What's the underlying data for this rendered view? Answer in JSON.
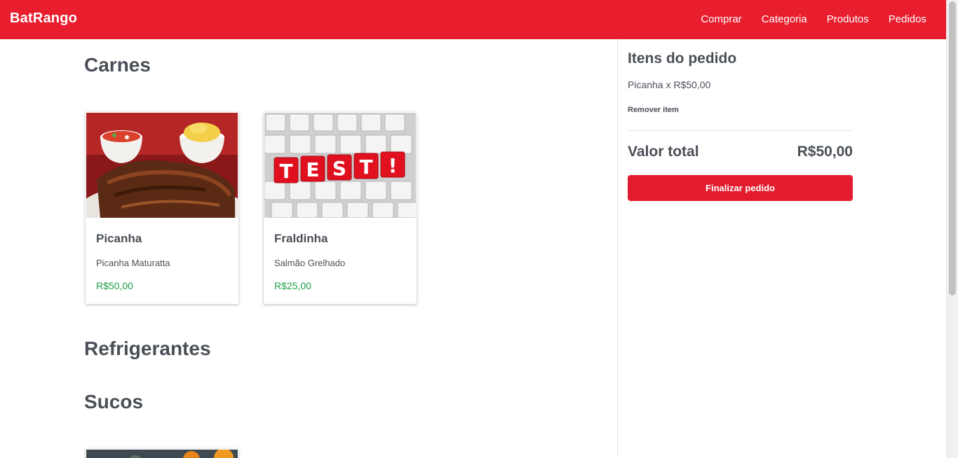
{
  "navbar": {
    "brand": "BatRango",
    "links": [
      "Comprar",
      "Categoria",
      "Produtos",
      "Pedidos"
    ]
  },
  "sections": [
    {
      "title": "Carnes",
      "products": [
        {
          "name": "Picanha",
          "description": "Picanha Maturatta",
          "price": "R$50,00",
          "image": "meat-dish-image"
        },
        {
          "name": "Fraldinha",
          "description": "Salmão Grelhado",
          "price": "R$25,00",
          "image": "test-keyboard-image"
        }
      ]
    },
    {
      "title": "Refrigerantes",
      "products": []
    },
    {
      "title": "Sucos",
      "products": [
        {
          "image": "juice-image"
        }
      ]
    }
  ],
  "sidebar": {
    "title": "Itens do pedido",
    "items": [
      {
        "text": "Picanha x R$50,00",
        "remove_label": "Remover item"
      }
    ],
    "total_label": "Valor total",
    "total_value": "R$50,00",
    "checkout_label": "Finalizar pedido"
  },
  "colors": {
    "primary": "#e81e2e",
    "price": "#1e9e48",
    "text": "#4a4f57"
  }
}
